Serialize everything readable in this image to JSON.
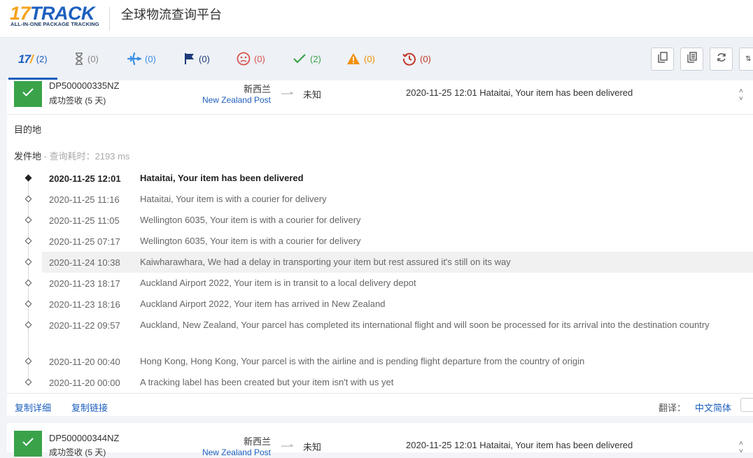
{
  "header": {
    "logo_num": "17",
    "logo_word": "TRACK",
    "logo_tagline": "ALL-IN-ONE PACKAGE TRACKING",
    "title": "全球物流查询平台"
  },
  "tabs": [
    {
      "icon": "17track-logo-icon",
      "count": "(2)",
      "color": "#1d5fbf"
    },
    {
      "icon": "hourglass-icon",
      "count": "(0)",
      "color": "#888888"
    },
    {
      "icon": "airplane-icon",
      "count": "(0)",
      "color": "#3a8ee6"
    },
    {
      "icon": "flag-icon",
      "count": "(0)",
      "color": "#1d3b7a"
    },
    {
      "icon": "sad-face-icon",
      "count": "(0)",
      "color": "#d9534f"
    },
    {
      "icon": "checkmark-icon",
      "count": "(2)",
      "color": "#3aa34a"
    },
    {
      "icon": "warning-icon",
      "count": "(0)",
      "color": "#f0900a"
    },
    {
      "icon": "expired-clock-icon",
      "count": "(0)",
      "color": "#c0392b"
    }
  ],
  "toolbar": [
    "copy-icon",
    "copy-all-icon",
    "refresh-icon",
    "more-icon"
  ],
  "shipments": [
    {
      "tracking_no": "DP500000335NZ",
      "status": "成功签收 (5 天)",
      "origin_country": "新西兰",
      "carrier": "New Zealand Post",
      "dest_country": "未知",
      "last_event": "2020-11-25 12:01  Hataitai, Your item has been delivered"
    },
    {
      "tracking_no": "DP500000344NZ",
      "status": "成功签收 (5 天)",
      "origin_country": "新西兰",
      "carrier": "New Zealand Post",
      "dest_country": "未知",
      "last_event": "2020-11-25 12:01  Hataitai, Your item has been delivered"
    }
  ],
  "detail": {
    "dest_label": "目的地",
    "origin_label": "发件地",
    "origin_meta": " - 查询耗时：2193 ms",
    "events": [
      {
        "time": "2020-11-25 12:01",
        "desc": "Hataitai, Your item has been delivered"
      },
      {
        "time": "2020-11-25 11:16",
        "desc": "Hataitai, Your item is with a courier for delivery"
      },
      {
        "time": "2020-11-25 11:05",
        "desc": "Wellington 6035, Your item is with a courier for delivery"
      },
      {
        "time": "2020-11-25 07:17",
        "desc": "Wellington 6035, Your item is with a courier for delivery"
      },
      {
        "time": "2020-11-24 10:38",
        "desc": "Kaiwharawhara, We had a delay in transporting your item but rest assured it's still on its way"
      },
      {
        "time": "2020-11-23 18:17",
        "desc": "Auckland Airport 2022, Your item is in transit to a local delivery depot"
      },
      {
        "time": "2020-11-23 18:16",
        "desc": "Auckland Airport 2022, Your item has arrived in New Zealand"
      },
      {
        "time": "2020-11-22 09:57",
        "desc": "Auckland, New Zealand, Your parcel has completed its international flight and will soon be processed for its arrival into the destination country"
      },
      {
        "time": "2020-11-20 00:40",
        "desc": "Hong Kong, Hong Kong, Your parcel is with the airline and is pending flight departure from the country of origin"
      },
      {
        "time": "2020-11-20 00:00",
        "desc": "A tracking label has been created but your item isn't with us yet"
      }
    ],
    "copy_detail": "复制详细",
    "copy_link": "复制链接",
    "translate_label": "翻译：",
    "translate_lang": "中文简体"
  }
}
